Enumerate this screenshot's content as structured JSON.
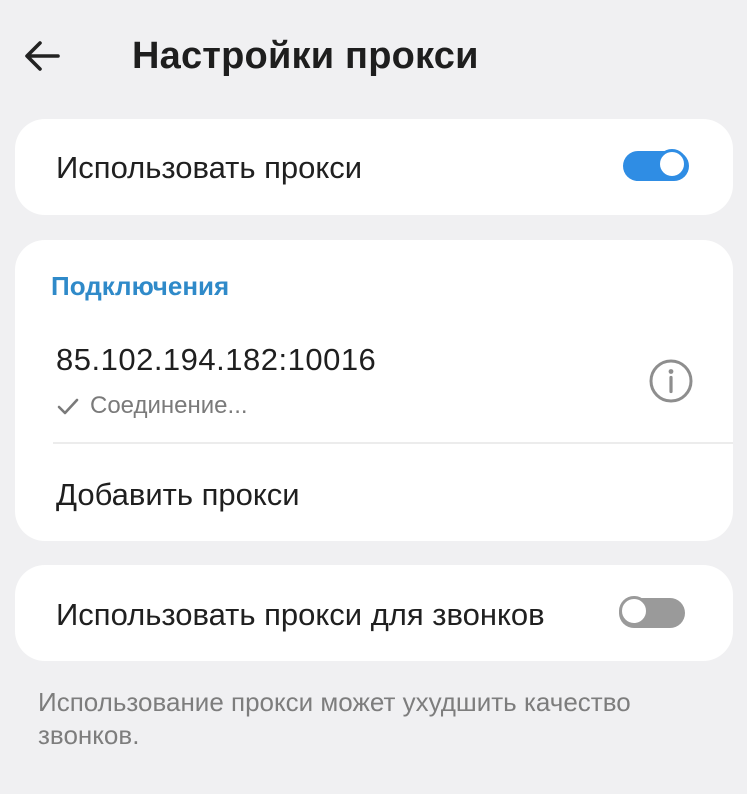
{
  "header": {
    "title": "Настройки прокси",
    "back_icon": "arrow-left-icon"
  },
  "use_proxy": {
    "label": "Использовать прокси",
    "enabled": true,
    "accent_color": "#2f8de4"
  },
  "connections": {
    "section_title": "Подключения",
    "section_color": "#2f8ac9",
    "items": [
      {
        "address": "85.102.194.182:10016",
        "status": "Соединение...",
        "status_icon": "check-icon",
        "info_icon": "info-icon"
      }
    ],
    "add_label": "Добавить прокси"
  },
  "calls_proxy": {
    "label": "Использовать прокси для звонков",
    "enabled": false
  },
  "footnote": "Использование прокси может ухудшить качество звонков."
}
